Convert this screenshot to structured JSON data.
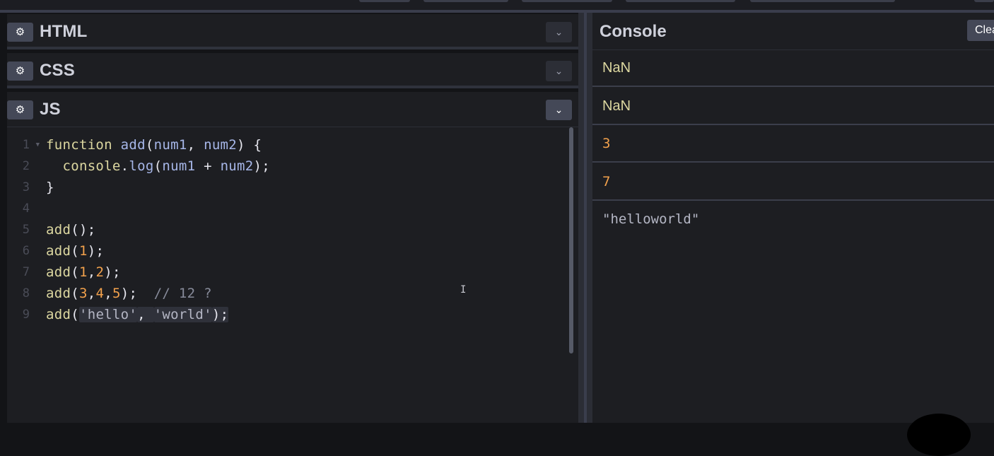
{
  "panels": [
    {
      "title": "HTML",
      "active": false
    },
    {
      "title": "CSS",
      "active": false
    },
    {
      "title": "JS",
      "active": true
    }
  ],
  "icons": {
    "settings": "gear-icon",
    "collapse": "chevron-down-icon"
  },
  "editor": {
    "line_numbers": [
      "1",
      "2",
      "3",
      "4",
      "5",
      "6",
      "7",
      "8",
      "9"
    ],
    "lines": [
      [
        {
          "t": "function ",
          "c": "kw"
        },
        {
          "t": "add",
          "c": "name"
        },
        {
          "t": "(",
          "c": ""
        },
        {
          "t": "num1",
          "c": "param"
        },
        {
          "t": ", ",
          "c": ""
        },
        {
          "t": "num2",
          "c": "param"
        },
        {
          "t": ") {",
          "c": ""
        }
      ],
      [
        {
          "t": "  console",
          "c": "kw"
        },
        {
          "t": ".",
          "c": ""
        },
        {
          "t": "log",
          "c": "prop"
        },
        {
          "t": "(",
          "c": ""
        },
        {
          "t": "num1",
          "c": "param"
        },
        {
          "t": " + ",
          "c": ""
        },
        {
          "t": "num2",
          "c": "param"
        },
        {
          "t": ");",
          "c": ""
        }
      ],
      [
        {
          "t": "}",
          "c": ""
        }
      ],
      [],
      [
        {
          "t": "add",
          "c": "fn"
        },
        {
          "t": "();",
          "c": ""
        }
      ],
      [
        {
          "t": "add",
          "c": "fn"
        },
        {
          "t": "(",
          "c": ""
        },
        {
          "t": "1",
          "c": "num"
        },
        {
          "t": ");",
          "c": ""
        }
      ],
      [
        {
          "t": "add",
          "c": "fn"
        },
        {
          "t": "(",
          "c": ""
        },
        {
          "t": "1",
          "c": "num"
        },
        {
          "t": ",",
          "c": ""
        },
        {
          "t": "2",
          "c": "num"
        },
        {
          "t": ");",
          "c": ""
        }
      ],
      [
        {
          "t": "add",
          "c": "fn"
        },
        {
          "t": "(",
          "c": ""
        },
        {
          "t": "3",
          "c": "num"
        },
        {
          "t": ",",
          "c": ""
        },
        {
          "t": "4",
          "c": "num"
        },
        {
          "t": ",",
          "c": ""
        },
        {
          "t": "5",
          "c": "num"
        },
        {
          "t": ");  ",
          "c": ""
        },
        {
          "t": "// 12 ?",
          "c": "cm"
        }
      ],
      [
        {
          "t": "add",
          "c": "fn"
        },
        {
          "t": "(",
          "c": ""
        },
        {
          "t": "'hello'",
          "c": "str sel"
        },
        {
          "t": ", ",
          "c": "sel"
        },
        {
          "t": "'world'",
          "c": "str sel"
        },
        {
          "t": ");",
          "c": "sel"
        }
      ]
    ]
  },
  "console": {
    "title": "Console",
    "clear_label": "Clear",
    "logs": [
      {
        "text": "NaN",
        "kind": "nan"
      },
      {
        "text": "NaN",
        "kind": "nan"
      },
      {
        "text": "3",
        "kind": "n"
      },
      {
        "text": "7",
        "kind": "n"
      },
      {
        "text": "\"helloworld\"",
        "kind": "s"
      }
    ]
  },
  "colors": {
    "background": "#131417",
    "panel": "#1d1e22",
    "keyword": "#dcd7a0",
    "number": "#f2a14c",
    "identifier": "#a7b7e9",
    "comment": "#878b9a"
  }
}
